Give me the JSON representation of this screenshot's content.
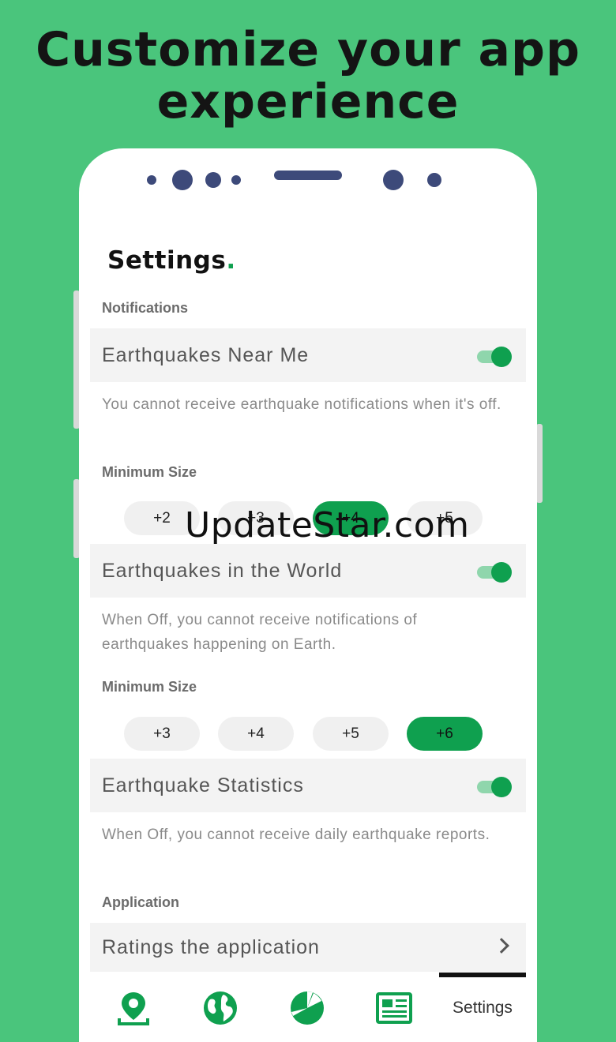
{
  "headline": {
    "line1": "Customize your app",
    "line2": "experience"
  },
  "settings": {
    "title": "Settings",
    "title_dot": ".",
    "sections": {
      "notifications": "Notifications",
      "application": "Application"
    },
    "near_me": {
      "label": "Earthquakes Near Me",
      "enabled": true,
      "description": "You cannot receive earthquake notifications when it's off.",
      "min_size_label": "Minimum Size",
      "options": [
        "+2",
        "+3",
        "+4",
        "+5"
      ],
      "selected": "+4"
    },
    "world": {
      "label": "Earthquakes in the World",
      "enabled": true,
      "description": "When Off, you cannot receive notifications of earthquakes happening on Earth.",
      "min_size_label": "Minimum Size",
      "options": [
        "+3",
        "+4",
        "+5",
        "+6"
      ],
      "selected": "+6"
    },
    "statistics": {
      "label": "Earthquake Statistics",
      "enabled": true,
      "description": "When Off, you cannot receive daily earthquake reports."
    },
    "rate": {
      "label": "Ratings the application"
    }
  },
  "watermark": "UpdateStar.com",
  "bottom_nav": {
    "items": [
      {
        "icon": "map-pin-icon"
      },
      {
        "icon": "globe-icon"
      },
      {
        "icon": "pie-chart-icon"
      },
      {
        "icon": "newspaper-icon"
      },
      {
        "label": "Settings",
        "active": true
      }
    ]
  },
  "colors": {
    "background": "#4ac57c",
    "accent": "#0fa04f",
    "device_dots": "#3d4a7a"
  }
}
